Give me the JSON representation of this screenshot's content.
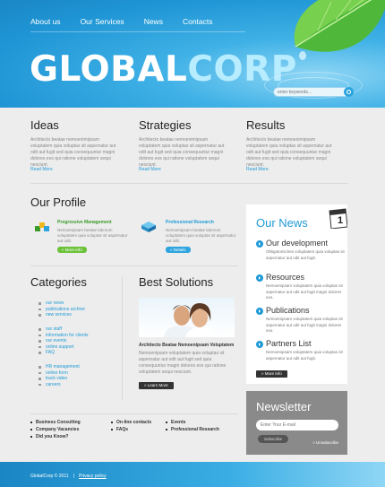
{
  "nav": [
    "About us",
    "Our Services",
    "News",
    "Contacts"
  ],
  "logo": {
    "part1": "GLOBAL",
    "part2": "CORP"
  },
  "search": {
    "placeholder": "enter keywords..."
  },
  "columns": [
    {
      "title": "Ideas",
      "text": "Architecto beatae nemoenimipsam voluptatem quia voluptas sit aspernatur aut odit aut fugit sed quia consequuntur magni dolores eos qui ratione voluptatem sequi nesciunt.",
      "more": "Read More"
    },
    {
      "title": "Strategies",
      "text": "Architecto beatae nemoenimipsam voluptatem quia voluptas sit aspernatur aut odit aut fugit sed quia consequuntur magni dolores eos qui ratione voluptatem sequi nesciunt.",
      "more": "Read More"
    },
    {
      "title": "Results",
      "text": "Architecto beatae nemoenimipsam voluptatem quia voluptas sit aspernatur aut odit aut fugit sed quia consequuntur magni dolores eos qui ratione voluptatem sequi nesciunt.",
      "more": "Read More"
    }
  ],
  "profile": {
    "title": "Our Profile",
    "items": [
      {
        "title": "Progressive Management",
        "text": "Nemoenipsam beatae laborum voluptatem quia voluptas sit aspernatur aut odit.",
        "button": "» More Info"
      },
      {
        "title": "Professional Research",
        "text": "Nemoenipsam beatae laborum voluptatem quia voluptas sit aspernatur aut odit.",
        "button": "» Details"
      }
    ]
  },
  "categories": {
    "title": "Categories",
    "groups": [
      [
        "our news",
        "publications archive",
        "new services"
      ],
      [
        "our staff",
        "information for clients",
        "our events",
        "online support",
        "FAQ"
      ],
      [
        "HR management",
        "online form",
        "track video",
        "careers"
      ]
    ]
  },
  "solutions": {
    "title": "Best Solutions",
    "caption": "Architecto Beatae Nemoenipsam Voluptatem",
    "text": "Nemoenipsam voluptatem quia voluptas sit aspernatur aut odit aut fugit sed quia consequuntur magni dolores eos qui ratione voluptatem sequi nesciunt.",
    "button": "» Learn More"
  },
  "news": {
    "title": "Our News",
    "calendar_day": "1",
    "items": [
      {
        "title": "Our development",
        "text": "Obligatorisches voluptatem quia voluptas sit aspernatur aut odit aut fugit."
      },
      {
        "title": "Resources",
        "text": "Nemoenipsam voluptatem quia voluptas sit aspernatur aut odit aut fugit magni dolores eos."
      },
      {
        "title": "Publications",
        "text": "Nemoenipsam voluptatem quia voluptas sit aspernatur aut odit aut fugit magni dolores eos."
      },
      {
        "title": "Partners List",
        "text": "Nemoenipsam voluptatem quia voluptas sit aspernatur aut odit aut fugit."
      }
    ],
    "button": "» More Info"
  },
  "newsletter": {
    "title": "Newsletter",
    "placeholder": "Enter Your E-mail",
    "button": "Subscribe",
    "unsubscribe": "» Unsubscribe"
  },
  "footer_links": [
    [
      "Business Consulting",
      "Company Vacancies",
      "Did you Know?"
    ],
    [
      "On-line contacts",
      "FAQs"
    ],
    [
      "Events",
      "Professional Research"
    ]
  ],
  "footer": {
    "copyright": "GlobalCorp © 2011",
    "privacy": "Privacy policy"
  }
}
